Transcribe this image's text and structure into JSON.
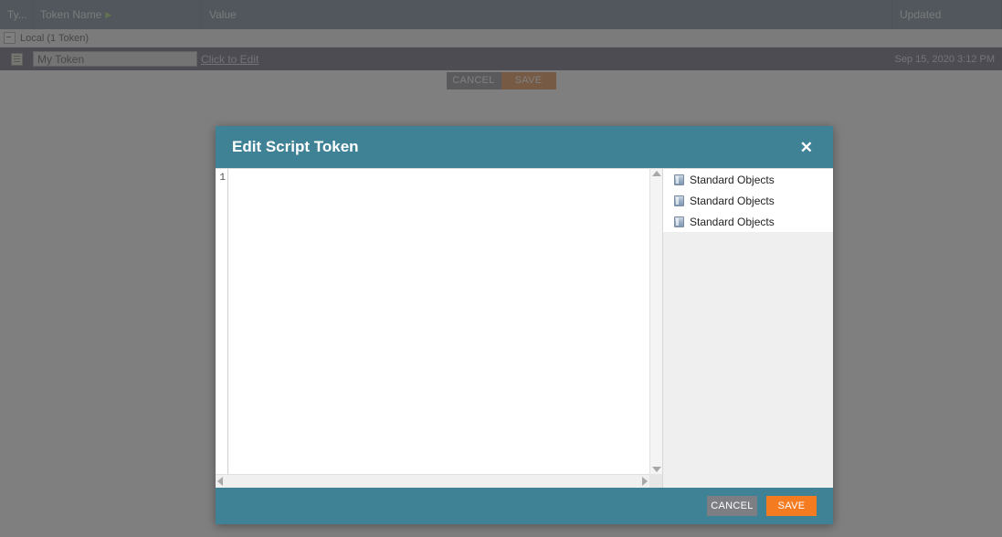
{
  "grid": {
    "columns": [
      {
        "key": "type",
        "label": "Ty..."
      },
      {
        "key": "name",
        "label": "Token Name",
        "sorted": true,
        "sort_arrow": "▶"
      },
      {
        "key": "value",
        "label": "Value"
      },
      {
        "key": "updated",
        "label": "Updated"
      }
    ],
    "group_row": {
      "label": "Local (1 Token)",
      "collapse_icon": "collapse-minus-icon"
    },
    "rows": [
      {
        "type_icon": "script-token-icon",
        "name_value": "My Token",
        "name_placeholder": "Token Name",
        "value_link": "Click to Edit",
        "updated": "Sep 15, 2020 3:12 PM"
      }
    ],
    "row_actions": {
      "cancel_label": "CANCEL",
      "save_label": "SAVE"
    }
  },
  "modal": {
    "title": "Edit Script Token",
    "close_icon": "close-icon",
    "editor": {
      "line_numbers": [
        "1"
      ],
      "content": "",
      "placeholder": "",
      "vertical_scroll": {
        "up_icon": "scroll-up-arrow-icon",
        "down_icon": "scroll-down-arrow-icon"
      },
      "horizontal_scroll": {
        "left_icon": "scroll-left-arrow-icon",
        "right_icon": "scroll-right-arrow-icon"
      }
    },
    "object_panel": {
      "items": [
        {
          "icon": "standard-objects-icon",
          "label": "Standard Objects"
        },
        {
          "icon": "standard-objects-icon",
          "label": "Standard Objects"
        },
        {
          "icon": "standard-objects-icon",
          "label": "Standard Objects"
        }
      ]
    },
    "footer": {
      "cancel_label": "CANCEL",
      "save_label": "SAVE"
    }
  },
  "colors": {
    "teal_header": "#3f8296",
    "orange_save": "#f47b20",
    "grey_cancel": "#7d7d84",
    "grid_header": "#5c7080",
    "selected_row": "#4b4a63",
    "sort_arrow_green": "#8fd14f"
  }
}
